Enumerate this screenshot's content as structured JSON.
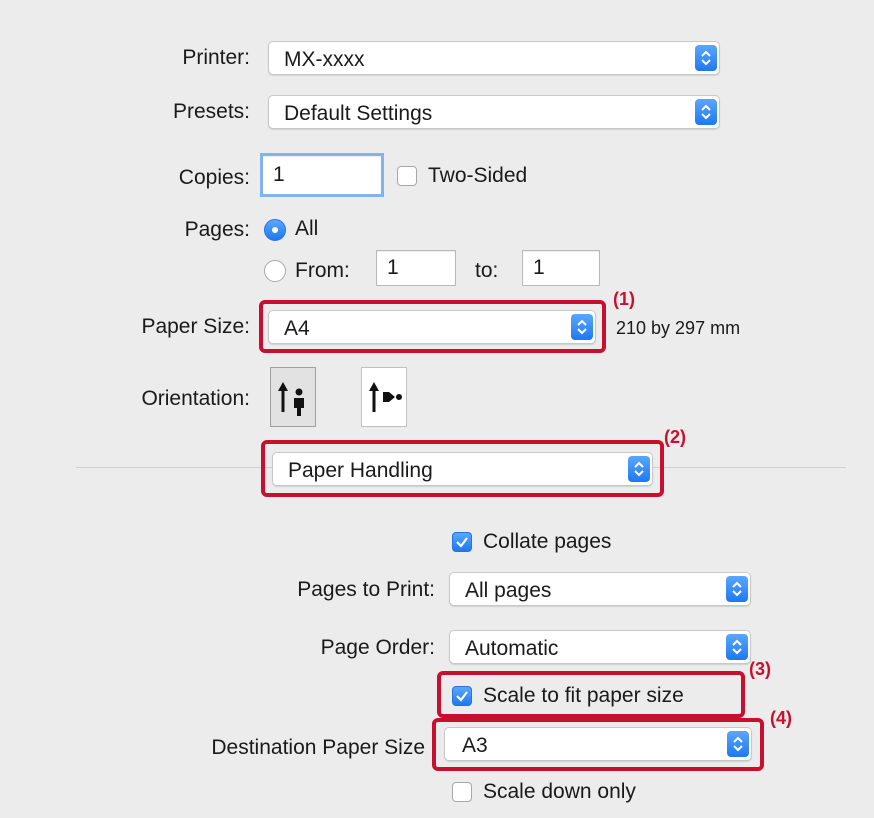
{
  "printer": {
    "label": "Printer:",
    "value": "MX-xxxx"
  },
  "presets": {
    "label": "Presets:",
    "value": "Default Settings"
  },
  "copies": {
    "label": "Copies:",
    "value": "1",
    "two_sided_label": "Two-Sided",
    "two_sided_checked": false
  },
  "pages": {
    "label": "Pages:",
    "all_label": "All",
    "from_label": "From:",
    "from_value": "1",
    "to_label": "to:",
    "to_value": "1",
    "selected": "All"
  },
  "paper_size": {
    "label": "Paper Size:",
    "value": "A4",
    "dimensions": "210 by 297 mm"
  },
  "orientation": {
    "label": "Orientation:",
    "options": [
      "portrait-icon",
      "landscape-icon"
    ],
    "selected": "portrait"
  },
  "section": {
    "value": "Paper Handling"
  },
  "paper_handling": {
    "collate_label": "Collate pages",
    "collate_checked": true,
    "pages_to_print_label": "Pages to Print:",
    "pages_to_print_value": "All pages",
    "page_order_label": "Page Order:",
    "page_order_value": "Automatic",
    "scale_fit_label": "Scale to fit paper size",
    "scale_fit_checked": true,
    "destination_label": "Destination Paper Size",
    "destination_value": "A3",
    "scale_down_label": "Scale down only",
    "scale_down_checked": false
  },
  "callouts": {
    "c1": "(1)",
    "c2": "(2)",
    "c3": "(3)",
    "c4": "(4)"
  },
  "colors": {
    "accent": "#1e78f0",
    "highlight": "#c8102e",
    "background": "#ececec"
  }
}
